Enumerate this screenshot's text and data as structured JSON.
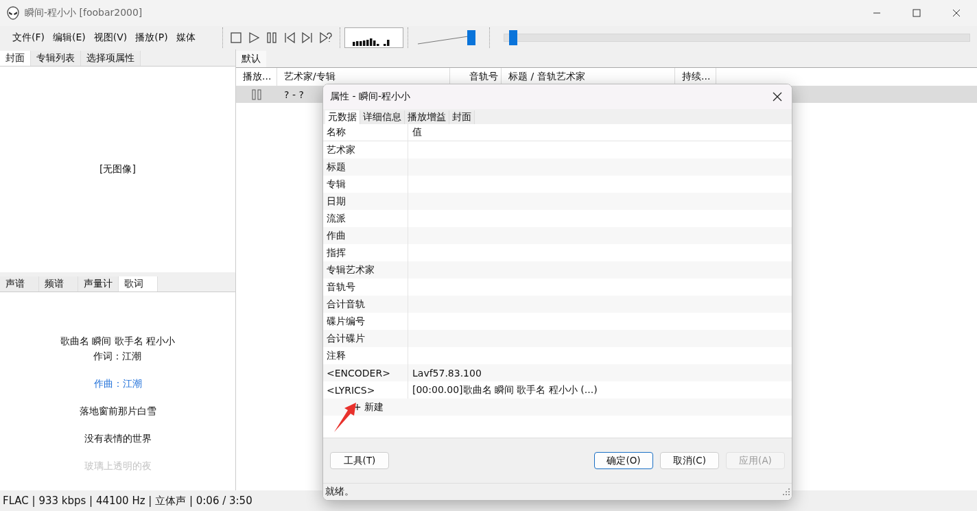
{
  "window": {
    "title": "瞬间-程小小  [foobar2000]"
  },
  "menu": [
    "文件(F)",
    "编辑(E)",
    "视图(V)",
    "播放(P)",
    "媒体"
  ],
  "volume": {
    "level": 0.97
  },
  "seek": {
    "level": 0.012
  },
  "left_tabs": [
    {
      "label": "封面",
      "selected": true
    },
    {
      "label": "专辑列表",
      "selected": false
    },
    {
      "label": "选择项属性",
      "selected": false
    }
  ],
  "cover": {
    "text": "[无图像]"
  },
  "bottom_tabs": [
    {
      "label": "声谱",
      "selected": false
    },
    {
      "label": "频谱",
      "selected": false
    },
    {
      "label": "声量计",
      "selected": false
    },
    {
      "label": "歌词",
      "selected": true
    }
  ],
  "lyrics": [
    {
      "texts": [
        "歌曲名 瞬间 歌手名 程小小",
        "作词：江潮"
      ],
      "kind": "normal"
    },
    {
      "texts": [
        "作曲：江潮"
      ],
      "kind": "current"
    },
    {
      "texts": [
        "落地窗前那片白雪"
      ],
      "kind": "normal"
    },
    {
      "texts": [
        "没有表情的世界"
      ],
      "kind": "normal"
    },
    {
      "texts": [
        "玻璃上透明的夜"
      ],
      "kind": "fading"
    }
  ],
  "playlist_tabs": [
    {
      "label": "默认",
      "selected": true
    }
  ],
  "playlist": {
    "columns": [
      "播放...",
      "艺术家/专辑",
      "音轨号",
      "标题 / 音轨艺术家",
      "持续..."
    ],
    "rows": [
      {
        "playing": true,
        "selected": true,
        "artist_album": "? - ?"
      }
    ]
  },
  "status_bar": "FLAC | 933 kbps | 44100 Hz | 立体声 | 0:06 / 3:50",
  "dialog": {
    "title": "属性 - 瞬间-程小小",
    "tabs": [
      {
        "label": "元数据",
        "selected": true
      },
      {
        "label": "详细信息",
        "selected": false
      },
      {
        "label": "播放增益",
        "selected": false
      },
      {
        "label": "封面",
        "selected": false
      }
    ],
    "columns": [
      "名称",
      "值"
    ],
    "rows": [
      {
        "name": "艺术家"
      },
      {
        "name": "标题"
      },
      {
        "name": "专辑"
      },
      {
        "name": "日期"
      },
      {
        "name": "流派"
      },
      {
        "name": "作曲"
      },
      {
        "name": "指挥"
      },
      {
        "name": "专辑艺术家"
      },
      {
        "name": "音轨号"
      },
      {
        "name": "合计音轨"
      },
      {
        "name": "碟片编号"
      },
      {
        "name": "合计碟片"
      },
      {
        "name": "注释"
      },
      {
        "name": "<ENCODER>",
        "value": "Lavf57.83.100"
      },
      {
        "name": "<LYRICS>",
        "value": "[00:00.00]歌曲名 瞬间 歌手名 程小小 (...)"
      }
    ],
    "add_label": "+ 新建",
    "buttons": [
      {
        "label": "工具(T)",
        "kind": "normal",
        "disabled": false
      },
      {
        "label": "确定(O)",
        "kind": "default",
        "disabled": false
      },
      {
        "label": "取消(C)",
        "kind": "normal",
        "disabled": false
      },
      {
        "label": "应用(A)",
        "kind": "normal",
        "disabled": true
      }
    ],
    "status": "就绪。"
  }
}
